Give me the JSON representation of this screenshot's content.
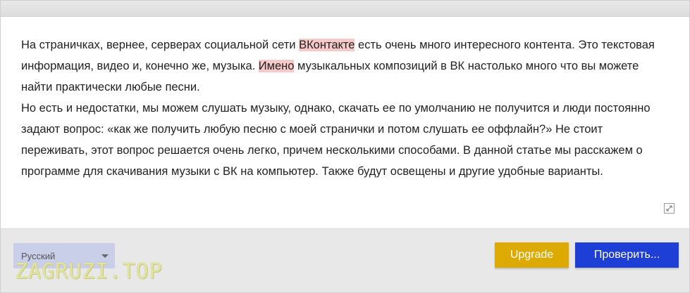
{
  "editor": {
    "paragraph1": {
      "part1": "На страничках, вернее, серверах социальной сети ",
      "highlight1": "ВКонтакте",
      "part2": " есть очень много интересного контента. Это текстовая информация, видео и, конечно же, музыка. ",
      "highlight2": "Имено",
      "part3": " музыкальных композиций в ВК настолько много что вы можете найти практически любые песни."
    },
    "paragraph2": "Но есть и недостатки, мы можем слушать музыку, однако, скачать ее по умолчанию не получится и люди постоянно задают вопрос: «как же получить любую песню с моей странички и потом слушать ее оффлайн?» Не стоит переживать, этот вопрос решается очень легко, причем несколькими способами. В данной статье мы расскажем о программе для скачивания музыки с ВК на компьютер. Также будут освещены и другие удобные варианты."
  },
  "footer": {
    "language": "Русский",
    "upgrade_label": "Upgrade",
    "check_label": "Проверить...",
    "watermark": "ZAGRUZI.TOP"
  },
  "colors": {
    "highlight": "#f8c9c9",
    "upgrade_button": "#dcaa02",
    "check_button": "#1e3fd6",
    "language_select": "#c9cfe9"
  },
  "icons": {
    "resize": "resize-icon",
    "dropdown": "chevron-down-icon"
  }
}
